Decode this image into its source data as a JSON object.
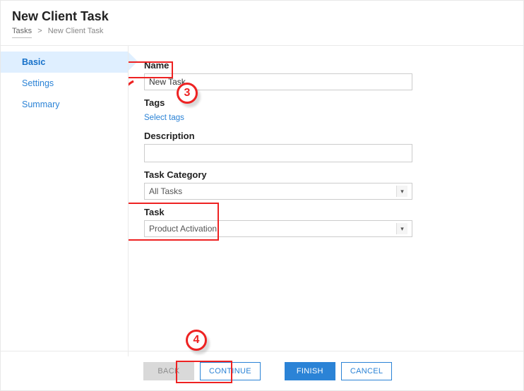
{
  "header": {
    "title": "New Client Task",
    "breadcrumb": {
      "root": "Tasks",
      "current": "New Client Task",
      "separator": ">"
    }
  },
  "sidebar": {
    "steps": [
      {
        "label": "Basic",
        "active": true
      },
      {
        "label": "Settings",
        "active": false
      },
      {
        "label": "Summary",
        "active": false
      }
    ]
  },
  "form": {
    "name": {
      "label": "Name",
      "value": "New Task"
    },
    "tags": {
      "label": "Tags",
      "select_link": "Select tags"
    },
    "description": {
      "label": "Description",
      "value": ""
    },
    "task_category": {
      "label": "Task Category",
      "value": "All Tasks"
    },
    "task": {
      "label": "Task",
      "value": "Product Activation"
    }
  },
  "footer": {
    "back": "BACK",
    "continue": "CONTINUE",
    "finish": "FINISH",
    "cancel": "CANCEL"
  },
  "annotations": {
    "step3_number": "3",
    "step4_number": "4"
  },
  "colors": {
    "accent": "#2b83d6",
    "annotation": "#e22020"
  }
}
